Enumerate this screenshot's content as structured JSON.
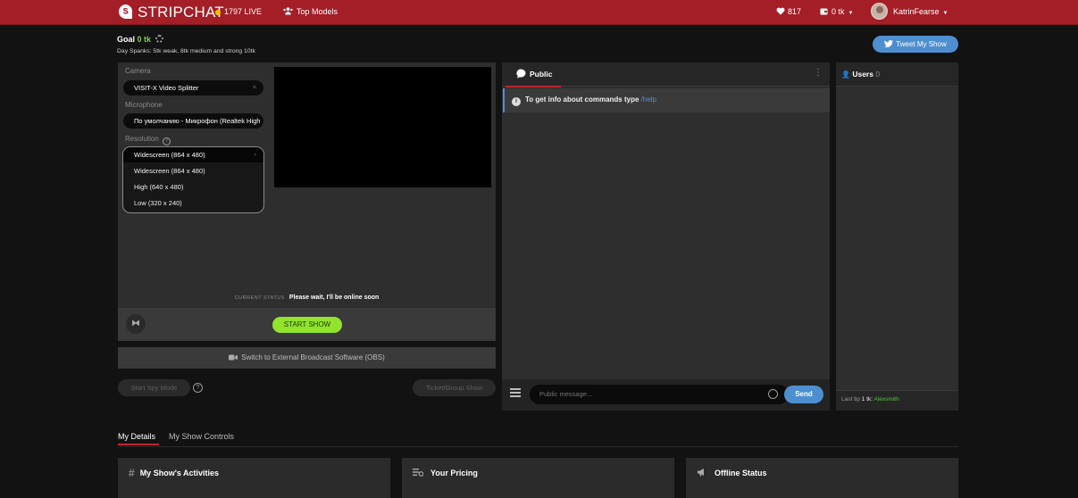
{
  "header": {
    "logo_text": "STRIPCHAT",
    "live_count": "1797 LIVE",
    "top_models": "Top Models",
    "likes": "817",
    "tokens": "0 tk",
    "username": "KatrinFearse",
    "colors": {
      "bar": "#a41e27",
      "live_dot": "#f3c300"
    }
  },
  "goal": {
    "label": "Goal",
    "value": "0 tk",
    "spanks": "Day Spanks: 5tk weak, 8tk medium and strong 10tk"
  },
  "tweet_button": "Tweet My Show",
  "broadcast": {
    "camera_label": "Camera",
    "camera_value": "VISIT-X Video Splitter",
    "microphone_label": "Microphone",
    "microphone_value": "По умолчанию - Микрофон (Realtek High",
    "resolution_label": "Resolution",
    "resolution_selected": "Widescreen (864 x 480)",
    "resolution_options": [
      "Widescreen (864 x 480)",
      "High (640 x 480)",
      "Low (320 x 240)"
    ],
    "status_label": "CURRENT STATUS",
    "status_text": "Please wait, I'll be online soon",
    "start_show": "START SHOW",
    "obs_switch": "Switch to External Broadcast Software (OBS)",
    "spy_mode": "Start Spy Mode",
    "ticket_show": "Ticket/Group Show"
  },
  "chat": {
    "tab_label": "Public",
    "info_text": "To get info about commands type",
    "info_link": "/help",
    "input_placeholder": "Public message...",
    "send": "Send"
  },
  "users": {
    "label": "Users",
    "count": "0",
    "last_tip_label": "Last tip",
    "last_tip_amount": "1 tk:",
    "last_tip_user": "Alexsmith"
  },
  "tabs": {
    "details": "My Details",
    "controls": "My Show Controls"
  },
  "cards": {
    "activities": "My Show's Activities",
    "pricing": "Your Pricing",
    "offline": "Offline Status"
  }
}
